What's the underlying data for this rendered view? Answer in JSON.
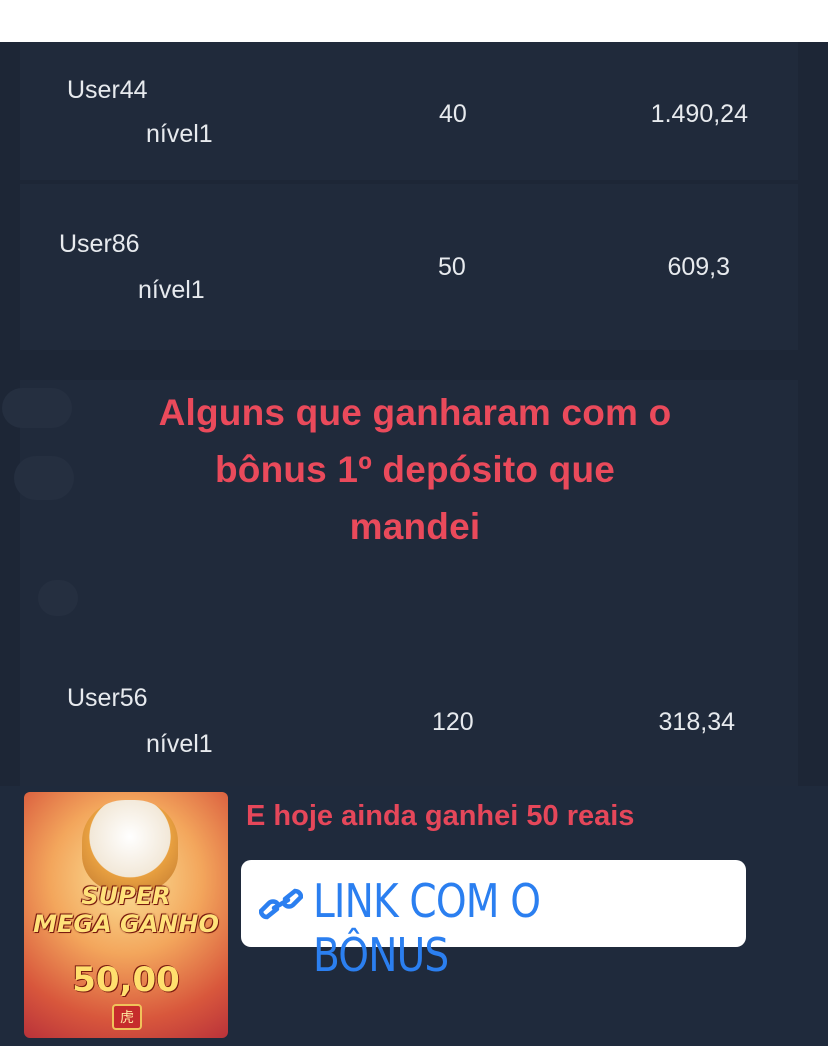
{
  "leaderboard": {
    "rows": [
      {
        "user": "User44",
        "level": "nível1",
        "count": "40",
        "amount": "1.490,24"
      },
      {
        "user": "User86",
        "level": "nível1",
        "count": "50",
        "amount": "609,3"
      },
      {
        "user": "User56",
        "level": "nível1",
        "count": "120",
        "amount": "318,34"
      }
    ]
  },
  "overlay": {
    "headline_line1": "Alguns que ganharam com o",
    "headline_line2": "bônus 1º depósito que",
    "headline_line3": "mandei",
    "color": "#ea4a5b"
  },
  "promo": {
    "thumb_text_line1": "SUPER",
    "thumb_text_line2": "MEGA GANHO",
    "thumb_value": "50,00",
    "thumb_stamp": "虎",
    "caption": "E hoje ainda ganhei 50 reais",
    "link_label": "LINK COM O BÔNUS",
    "link_icon": "link-icon",
    "link_color": "#2b7ff0"
  }
}
